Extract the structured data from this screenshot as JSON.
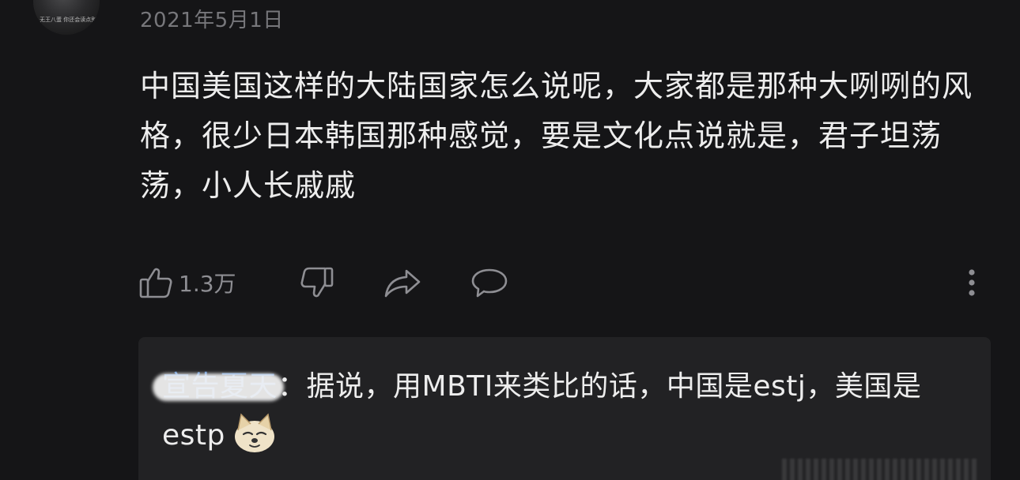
{
  "comment": {
    "date": "2021年5月1日",
    "body": "中国美国这样的大陆国家怎么说呢，大家都是那种大咧咧的风格，很少日本韩国那种感觉，要是文化点说就是，君子坦荡荡，小人长戚戚",
    "avatar_text": "无王八蛋 你还会读点别"
  },
  "actions": {
    "like_count": "1.3万",
    "icons": [
      "thumbs-up-icon",
      "thumbs-down-icon",
      "share-icon",
      "comment-icon",
      "more-vertical-icon"
    ]
  },
  "reply": {
    "user": "宣告夏天",
    "separator": "：",
    "text": "据说，用MBTI来类比的话，中国是estj，美国是estp",
    "emoji": "doge-emoji"
  },
  "colors": {
    "background": "#151517",
    "reply_background": "#222224",
    "username_link": "#5b8fd6",
    "muted": "#8e8e93"
  }
}
